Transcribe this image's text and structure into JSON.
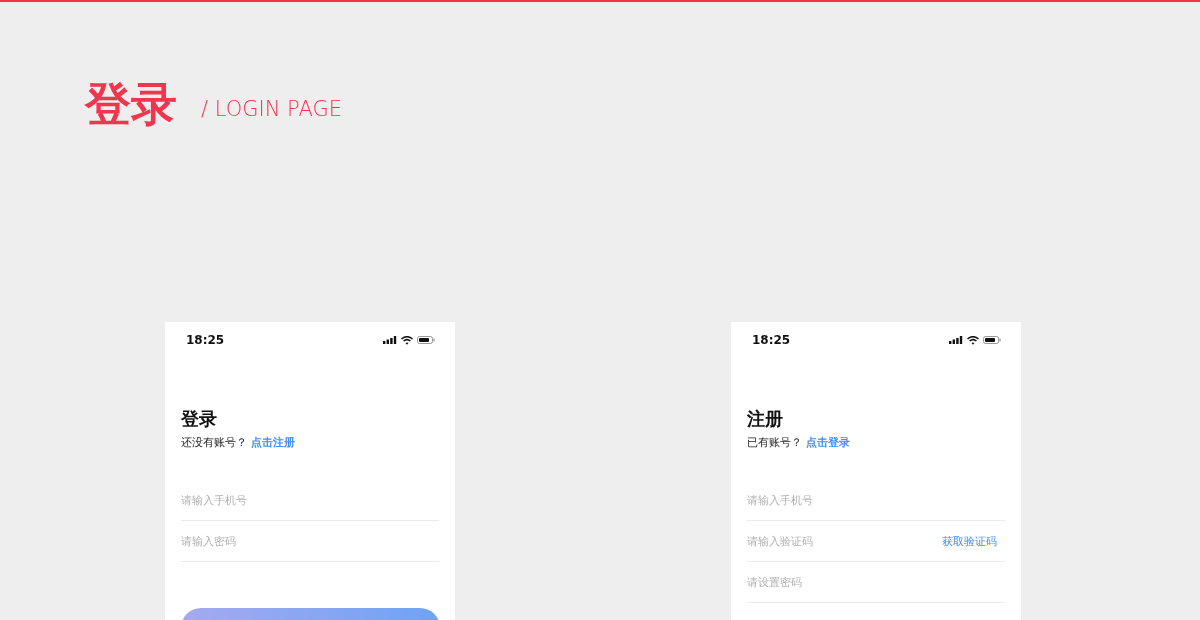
{
  "header": {
    "title": "登录",
    "subtitle": "/ LOGIN PAGE"
  },
  "screens": [
    {
      "status_bar": {
        "time": "18:25"
      },
      "title": "登录",
      "prompt": "还没有账号？",
      "link": "点击注册",
      "fields": [
        {
          "placeholder": "请输入手机号"
        },
        {
          "placeholder": "请输入密码"
        }
      ],
      "submit_button": true
    },
    {
      "status_bar": {
        "time": "18:25"
      },
      "title": "注册",
      "prompt": "已有账号？",
      "link": "点击登录",
      "fields": [
        {
          "placeholder": "请输入手机号"
        },
        {
          "placeholder": "请输入验证码",
          "action": "获取验证码"
        },
        {
          "placeholder": "请设置密码"
        }
      ],
      "submit_button": false
    }
  ]
}
